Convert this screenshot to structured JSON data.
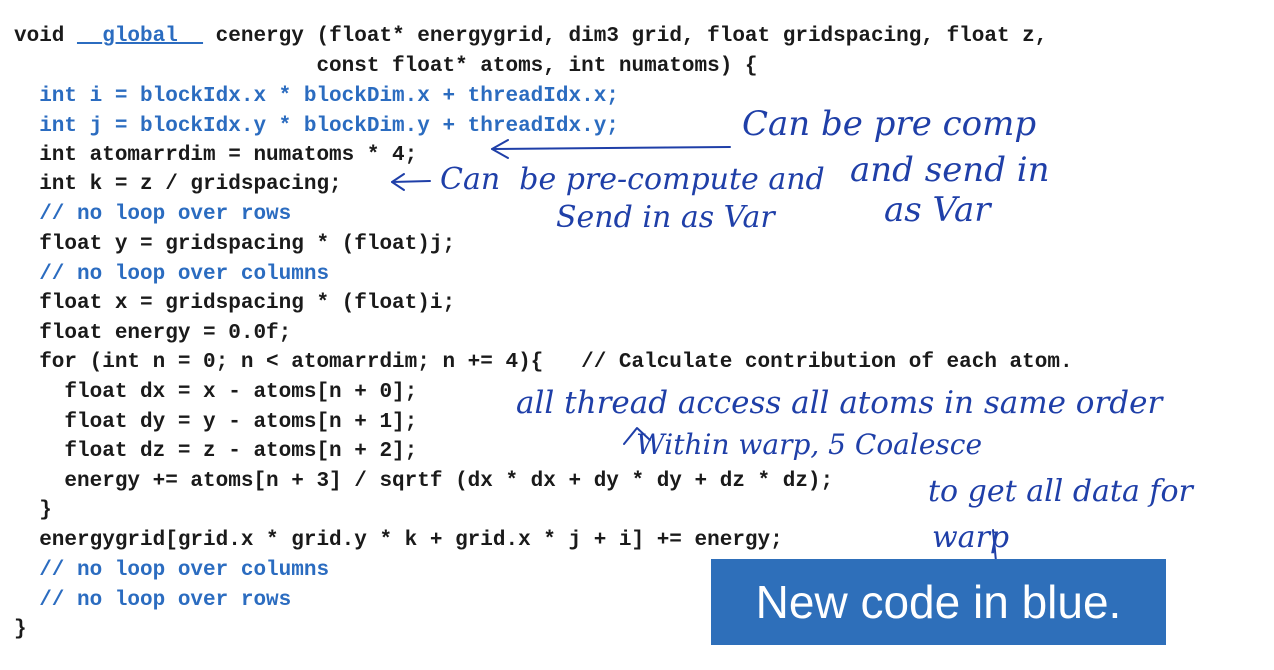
{
  "code": {
    "lines": [
      {
        "pre": "void ",
        "kw": "__global__",
        "post": " cenergy (float* energygrid, dim3 grid, float gridspacing, float z,"
      },
      "                        const float* atoms, int numatoms) {",
      "  int i = blockIdx.x * blockDim.x + threadIdx.x;",
      "  int j = blockIdx.y * blockDim.y + threadIdx.y;",
      "  int atomarrdim = numatoms * 4;",
      "  int k = z / gridspacing;",
      "  // no loop over rows",
      "  float y = gridspacing * (float)j;",
      "  // no loop over columns",
      "  float x = gridspacing * (float)i;",
      "  float energy = 0.0f;",
      "  for (int n = 0; n < atomarrdim; n += 4){   // Calculate contribution of each atom.",
      "    float dx = x - atoms[n + 0];",
      "    float dy = y - atoms[n + 1];",
      "    float dz = z - atoms[n + 2];",
      "    energy += atoms[n + 3] / sqrtf (dx * dx + dy * dy + dz * dz);",
      "  }",
      "  energygrid[grid.x * grid.y * k + grid.x * j + i] += energy;",
      "  // no loop over columns",
      "  // no loop over rows",
      "}"
    ]
  },
  "badge": {
    "label": "New code in blue."
  },
  "annotations": {
    "note1_line1": "Can be pre comp",
    "note1_line2": "and send in",
    "note1_line3": "as Var",
    "note2_line1": "Can  be pre-compute and",
    "note2_line2": "Send in as Var",
    "note3": "all thread access all atoms in same order",
    "note4_line1": "Within warp, 5 Coalesce",
    "note4_line2": "to get all data for",
    "note4_line3": "warp"
  },
  "colors": {
    "code_new": "#2b6cc0",
    "code_old": "#1a1a1a",
    "badge_bg": "#2e6fba",
    "ink": "#1f3fa8"
  }
}
